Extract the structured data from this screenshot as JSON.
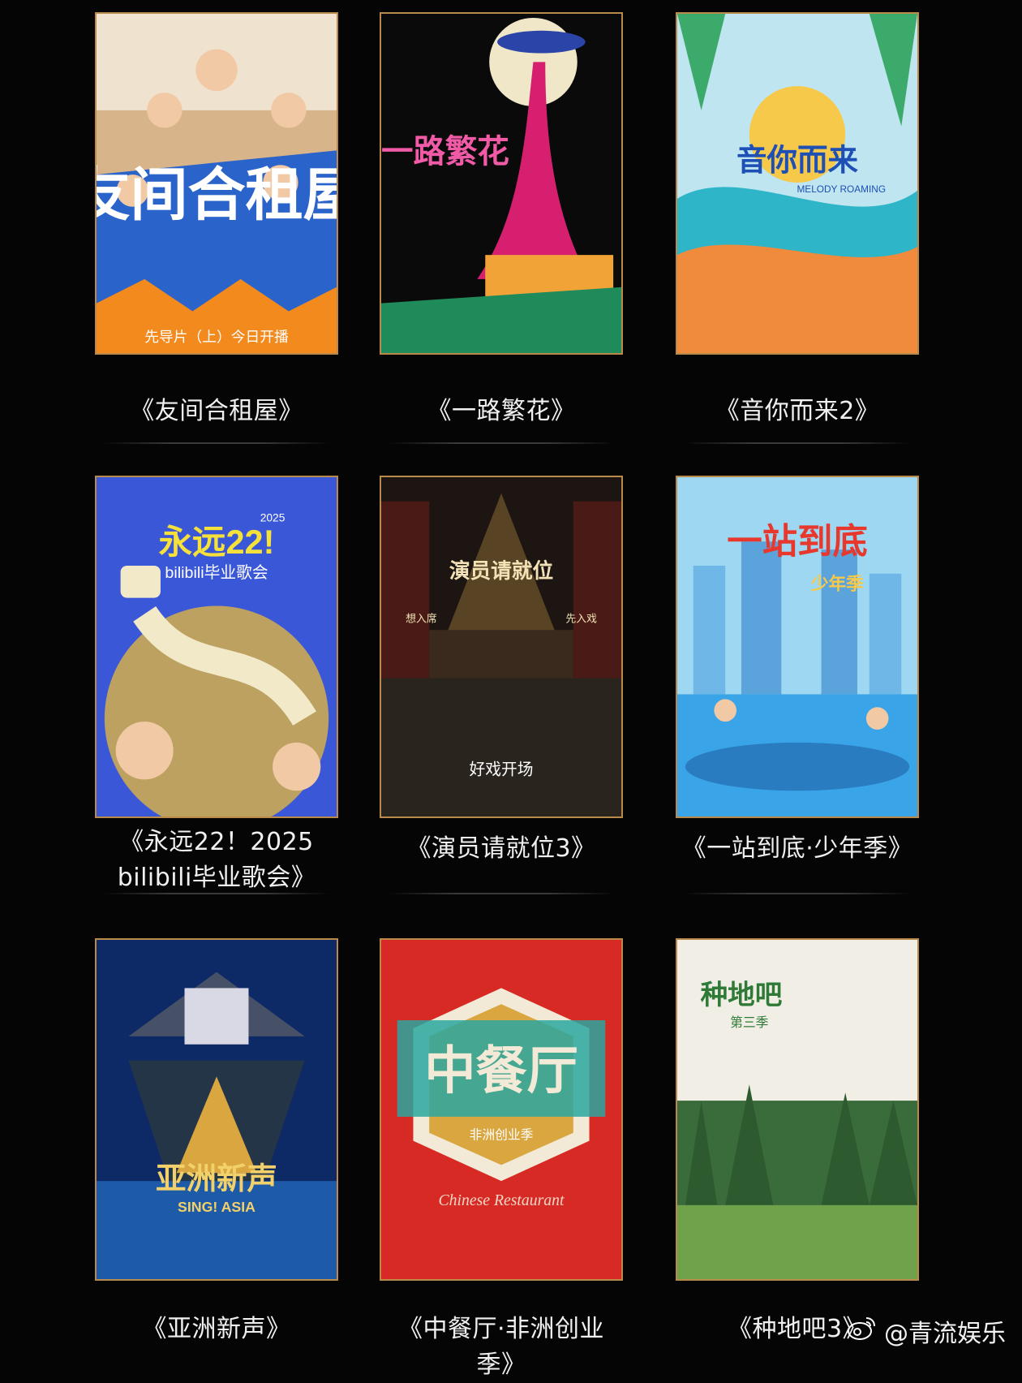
{
  "shows": [
    {
      "title": "《友间合租屋》",
      "poster_text": [
        "友间合租屋",
        "先导片（上）今日开播"
      ],
      "accent": "#2a63c9"
    },
    {
      "title": "《一路繁花》",
      "poster_text": [
        "一路繁花"
      ],
      "accent": "#d6206f"
    },
    {
      "title": "《音你而来2》",
      "poster_text": [
        "音你而来",
        "MELODY ROAMING"
      ],
      "accent": "#2fb5c8"
    },
    {
      "title_line1": "《永远22！2025",
      "title_line2": "bilibili毕业歌会》",
      "poster_text": [
        "永远22!",
        "2025",
        "bilibili毕业歌会"
      ],
      "accent": "#3a57d8"
    },
    {
      "title": "《演员请就位3》",
      "poster_text": [
        "演员请就位",
        "想入席",
        "先入戏",
        "好戏开场"
      ],
      "accent": "#c89b4a"
    },
    {
      "title": "《一站到底·少年季》",
      "poster_text": [
        "一站到底",
        "少年季"
      ],
      "accent": "#3aa4e8"
    },
    {
      "title": "《亚洲新声》",
      "poster_text": [
        "亚洲新声",
        "SING! ASIA"
      ],
      "accent": "#d9a640"
    },
    {
      "title": "《中餐厅·非洲创业季》",
      "poster_text": [
        "中餐厅",
        "非洲创业季",
        "Chinese Restaurant"
      ],
      "accent": "#d82a25"
    },
    {
      "title": "《种地吧3》",
      "poster_text": [
        "种地吧",
        "第三季"
      ],
      "accent": "#3f7a3a"
    }
  ],
  "watermark": {
    "text": "@青流娱乐",
    "icon": "weibo-icon"
  }
}
